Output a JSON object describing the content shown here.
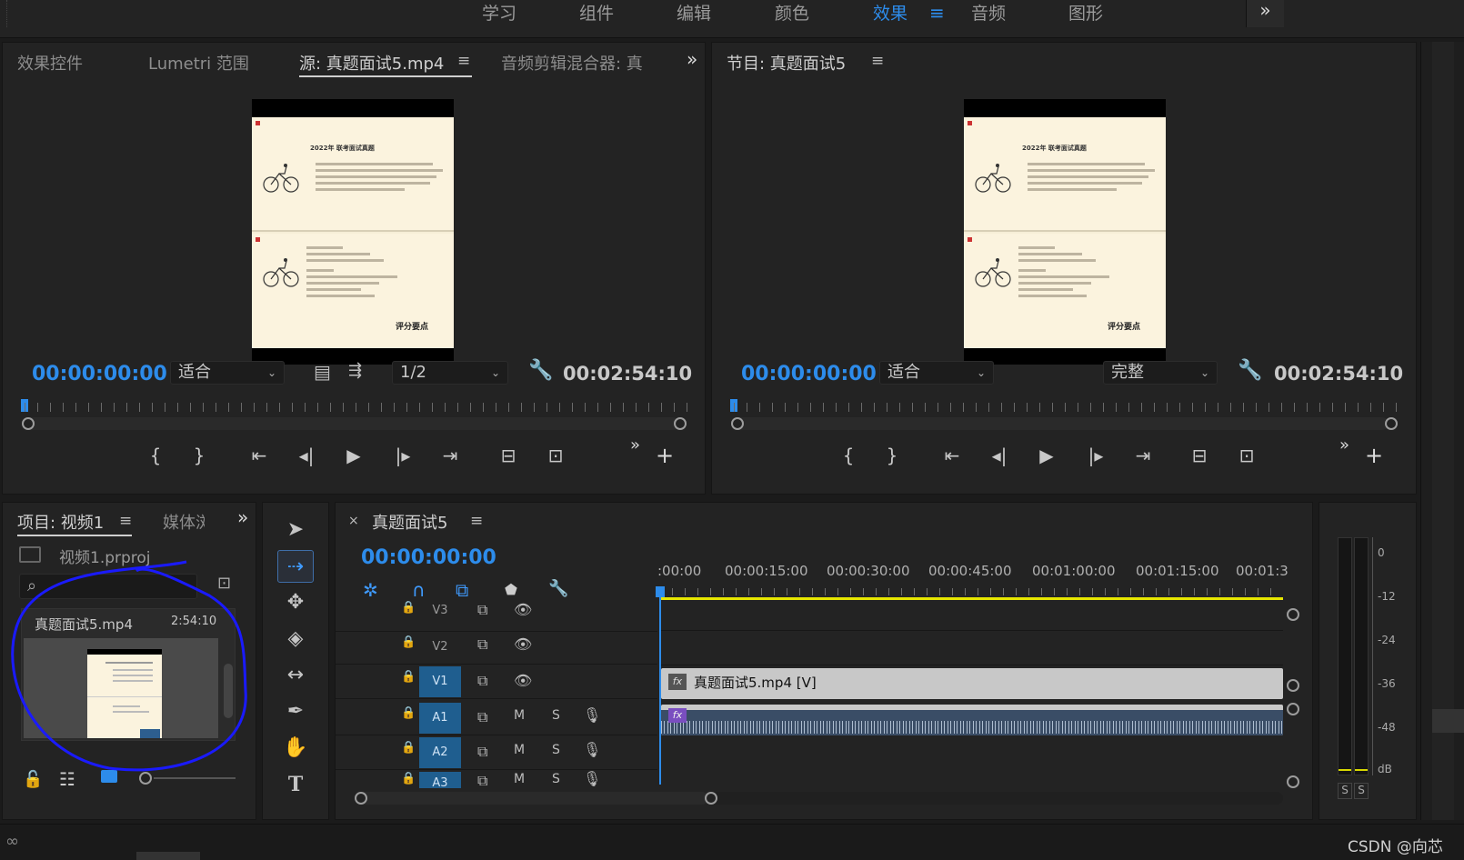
{
  "workspaces": [
    "学习",
    "组件",
    "编辑",
    "颜色",
    "效果",
    "音频",
    "图形"
  ],
  "active_workspace": "效果",
  "source_panel": {
    "tabs": [
      "效果控件",
      "Lumetri 范围",
      "源: 真题面试5.mp4",
      "音频剪辑混合器: 真"
    ],
    "timecode": "00:00:00:00",
    "fit": "适合",
    "resolution": "1/2",
    "duration": "00:02:54:10"
  },
  "program_panel": {
    "title": "节目: 真题面试5",
    "timecode": "00:00:00:00",
    "fit": "适合",
    "quality": "完整",
    "duration": "00:02:54:10"
  },
  "video_frame": {
    "top_title": "2022年 联考面试真题",
    "bottom_caption": "评分要点"
  },
  "project_panel": {
    "tab": "项目: 视频1",
    "tab2": "媒体浏",
    "project_file": "视频1.prproj",
    "clip_name": "真题面试5.mp4",
    "clip_duration": "2:54:10"
  },
  "timeline": {
    "tab_close": "×",
    "sequence": "真题面试5",
    "timecode": "00:00:00:00",
    "ruler": [
      ":00:00",
      "00:00:15:00",
      "00:00:30:00",
      "00:00:45:00",
      "00:01:00:00",
      "00:01:15:00",
      "00:01:3"
    ],
    "video_tracks": [
      "V3",
      "V2",
      "V1"
    ],
    "audio_tracks": [
      "A1",
      "A2",
      "A3"
    ],
    "track_m": "M",
    "track_s": "S",
    "clip_video": "真题面试5.mp4 [V]",
    "fx": "fx"
  },
  "meter": {
    "scale": [
      "0",
      "-12",
      "-24",
      "-36",
      "-48",
      "dB"
    ],
    "solo": [
      "S",
      "S"
    ]
  },
  "watermark": "CSDN @向芯",
  "colors": {
    "accent": "#2d8ceb",
    "annotation": "#1a1aff",
    "playhead": "#2d8ceb",
    "work_area": "#e6e600"
  }
}
